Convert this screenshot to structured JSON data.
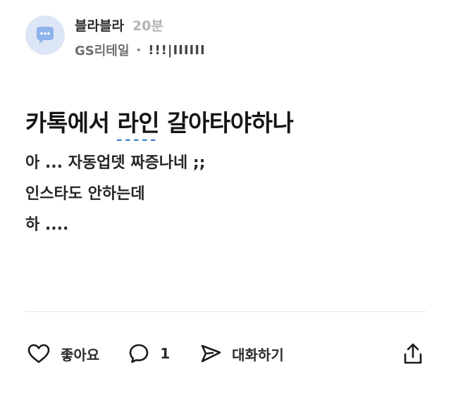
{
  "author": {
    "nickname": "블라블라",
    "time": "20분",
    "company": "GS리테일",
    "separator": "·",
    "job": "!!!|IIIIII",
    "avatar_icon": "chat-bubble-icon",
    "avatar_bg": "#dde6f6"
  },
  "post": {
    "title_before": "카톡에서 ",
    "title_highlight": "라인",
    "title_after": " 갈아타야하나",
    "body": [
      "아 ... 자동업뎃 짜증나네 ;;",
      "인스타도 안하는데",
      "하 ...."
    ]
  },
  "actions": {
    "like_label": "좋아요",
    "like_icon": "heart-icon",
    "comment_count": "1",
    "comment_icon": "comment-icon",
    "message_label": "대화하기",
    "message_icon": "paper-plane-icon",
    "share_icon": "share-icon"
  },
  "colors": {
    "highlight_underline": "#2f7ad6",
    "muted_text": "#b4b4b4"
  }
}
